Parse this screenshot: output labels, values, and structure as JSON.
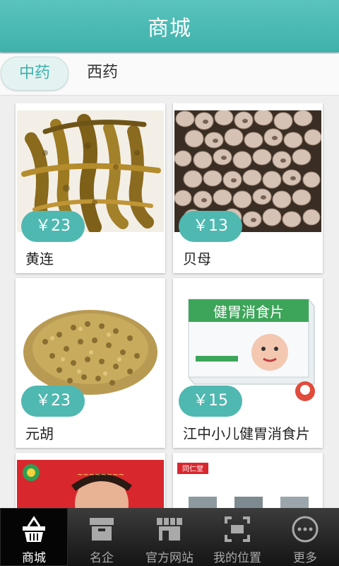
{
  "header": {
    "title": "商城"
  },
  "tabs": [
    {
      "label": "中药",
      "active": true
    },
    {
      "label": "西药",
      "active": false
    }
  ],
  "products": [
    {
      "name": "黄连",
      "price": "￥23",
      "image": "huanglian-root-photo"
    },
    {
      "name": "贝母",
      "price": "￥13",
      "image": "beimu-bulb-photo"
    },
    {
      "name": "元胡",
      "price": "￥23",
      "image": "yuanhu-tuber-photo"
    },
    {
      "name": "江中小儿健胃消食片",
      "price": "￥15",
      "image": "medicine-box-photo",
      "box_text": "健胃消食片"
    },
    {
      "name": "",
      "price": "",
      "image": "red-product-photo"
    },
    {
      "name": "",
      "price": "",
      "image": "tongrentang-product-photo",
      "box_text": "同仁堂"
    }
  ],
  "bottom_nav": [
    {
      "label": "商城",
      "icon": "basket-icon",
      "active": true
    },
    {
      "label": "名企",
      "icon": "box-icon",
      "active": false
    },
    {
      "label": "官方网站",
      "icon": "storefront-icon",
      "active": false
    },
    {
      "label": "我的位置",
      "icon": "scan-icon",
      "active": false
    },
    {
      "label": "更多",
      "icon": "more-icon",
      "active": false
    }
  ],
  "colors": {
    "accent": "#3fb1ab",
    "price_badge": "#4fb8b1",
    "navbar": "#1e1e1e"
  }
}
